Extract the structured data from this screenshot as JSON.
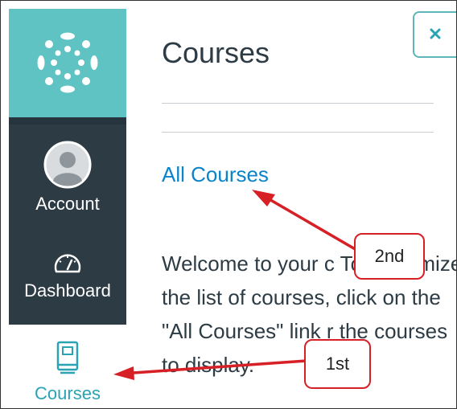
{
  "nav": {
    "account_label": "Account",
    "dashboard_label": "Dashboard",
    "courses_label": "Courses"
  },
  "tray": {
    "title": "Courses",
    "all_courses_link": "All Courses",
    "welcome_text": "Welcome to your c  To customize the list of courses, click on the \"All Courses\" link  r the courses to display."
  },
  "close_label": "×",
  "annotations": {
    "first": "1st",
    "second": "2nd"
  },
  "colors": {
    "logo_bg": "#5ec3c2",
    "nav_bg": "#2d3b45",
    "link": "#0b84c9",
    "active_courses": "#2aa3b4",
    "callout_red": "#d71f26"
  }
}
